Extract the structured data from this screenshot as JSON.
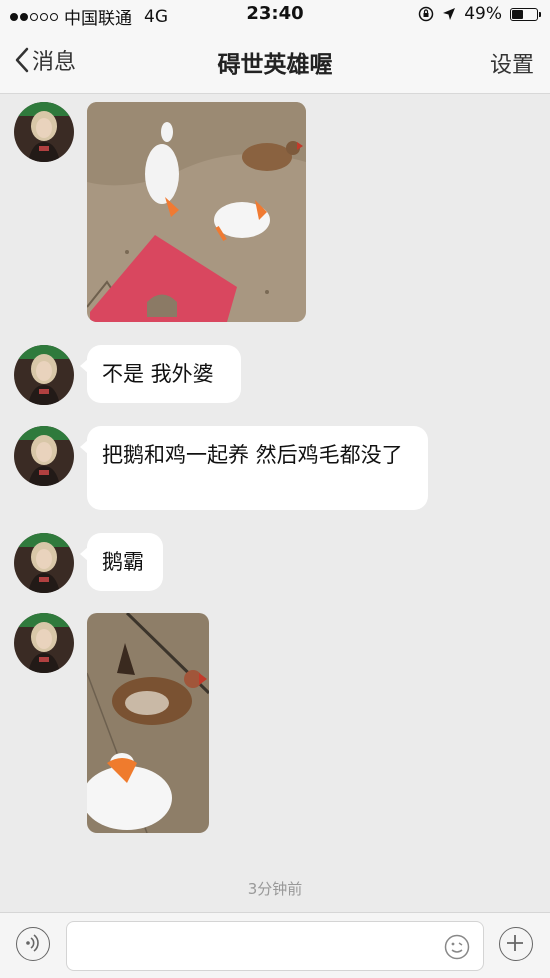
{
  "status_bar": {
    "carrier": "中国联通",
    "network": "4G",
    "time": "23:40",
    "battery_percent": "49%",
    "battery_level": 0.49,
    "signal_bars_filled": 2,
    "signal_bars_total": 5,
    "icons": [
      "orientation-lock-icon",
      "location-arrow-icon",
      "battery-icon"
    ]
  },
  "nav": {
    "back_label": "消息",
    "title": "碍世英雄喔",
    "settings_label": "设置"
  },
  "messages": [
    {
      "type": "image",
      "description_icon": "photo-geese-chickens"
    },
    {
      "type": "text",
      "text": "不是 我外婆"
    },
    {
      "type": "text",
      "text": "把鹅和鸡一起养 然后鸡毛都没了"
    },
    {
      "type": "text",
      "text": "鹅霸"
    },
    {
      "type": "image",
      "description_icon": "photo-goose-chicken"
    }
  ],
  "timestamp": "3分钟前",
  "input": {
    "placeholder": "",
    "value": ""
  },
  "colors": {
    "background": "#ebebeb",
    "bubble": "#ffffff",
    "bar": "#f7f7f7"
  }
}
